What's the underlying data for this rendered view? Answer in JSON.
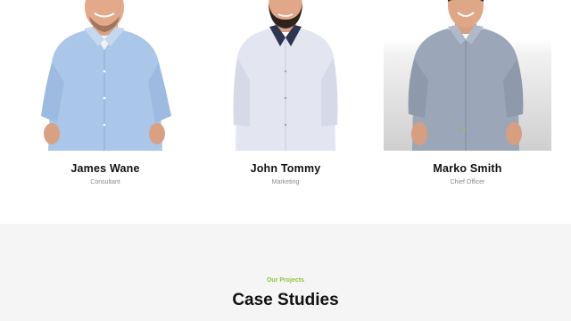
{
  "team": {
    "members": [
      {
        "name": "James Wane",
        "role": "Consultant",
        "photo": "man-blue-checked-shirt-photo"
      },
      {
        "name": "John Tommy",
        "role": "Marketing",
        "photo": "man-white-shirt-beard-photo"
      },
      {
        "name": "Marko Smith",
        "role": "Chief Officer",
        "photo": "man-grey-shirt-smiling-photo",
        "social": [
          "facebook-icon",
          "twitter-icon"
        ]
      }
    ]
  },
  "projects": {
    "eyebrow": "Our Projects",
    "heading": "Case Studies"
  },
  "colors": {
    "accent": "#8cc63f",
    "section_bg": "#f5f5f5",
    "heading": "#111111"
  }
}
